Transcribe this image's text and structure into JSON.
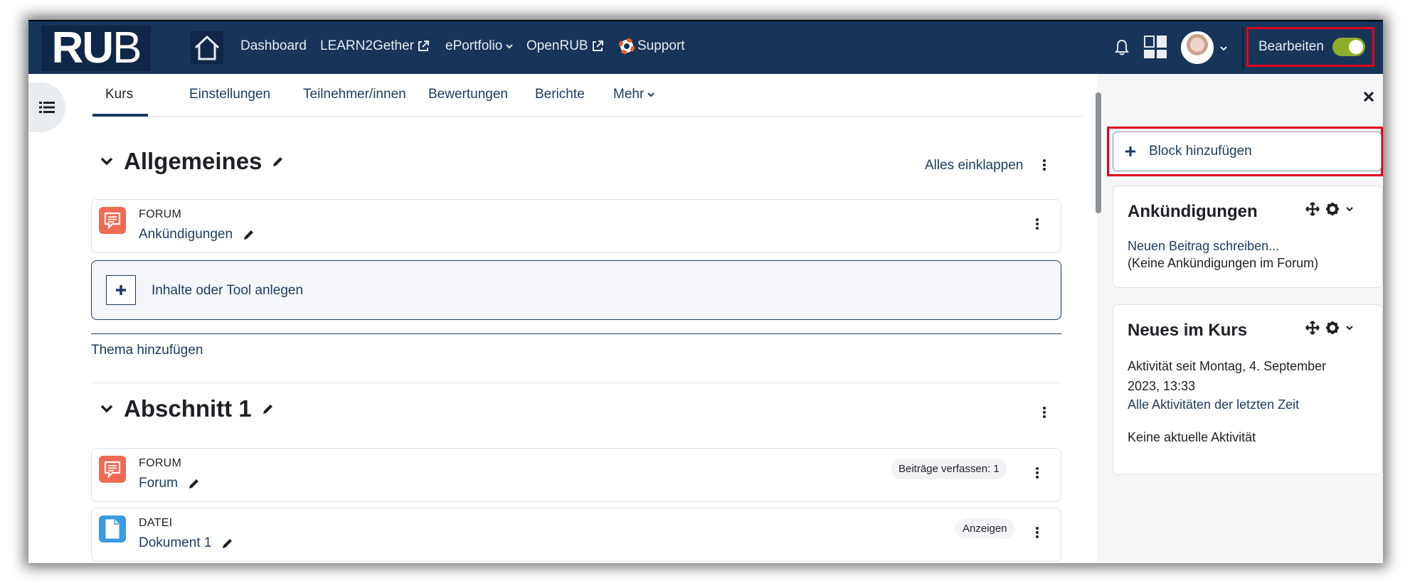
{
  "nav": {
    "logo_text_bold": "RU",
    "logo_text_thin": "B",
    "links": {
      "dashboard": "Dashboard",
      "learn2gether": "LEARN2Gether",
      "eportfolio": "ePortfolio",
      "openrub": "OpenRUB",
      "support": "Support"
    },
    "edit_label": "Bearbeiten",
    "edit_mode_on": true
  },
  "tabs": {
    "kurs": "Kurs",
    "einstellungen": "Einstellungen",
    "teilnehmer": "Teilnehmer/innen",
    "bewertungen": "Bewertungen",
    "berichte": "Berichte",
    "mehr": "Mehr"
  },
  "sections": {
    "general": {
      "title": "Allgemeines",
      "collapse_all": "Alles einklappen",
      "activity": {
        "type": "FORUM",
        "name": "Ankündigungen"
      },
      "add_content": "Inhalte oder Tool anlegen",
      "add_topic": "Thema hinzufügen"
    },
    "section1": {
      "title": "Abschnitt 1",
      "activities": [
        {
          "type": "FORUM",
          "name": "Forum",
          "badge": "Beiträge verfassen: 1"
        },
        {
          "type": "DATEI",
          "name": "Dokument 1",
          "badge": "Anzeigen"
        }
      ]
    }
  },
  "drawer": {
    "add_block": "Block hinzufügen",
    "announcements": {
      "title": "Ankündigungen",
      "link": "Neuen Beitrag schreiben...",
      "text": "(Keine Ankündigungen im Forum)"
    },
    "recent": {
      "title": "Neues im Kurs",
      "since_line1": "Aktivität seit Montag, 4. September",
      "since_line2": "2023, 13:33",
      "link": "Alle Aktivitäten der letzten Zeit",
      "none": "Keine aktuelle Aktivität"
    }
  },
  "colors": {
    "navbar": "#173559",
    "link": "#1d3b5e",
    "highlight": "#e0001a",
    "forum_icon": "#f06a55",
    "file_icon": "#399be2",
    "toggle_on": "#8fae2c"
  }
}
